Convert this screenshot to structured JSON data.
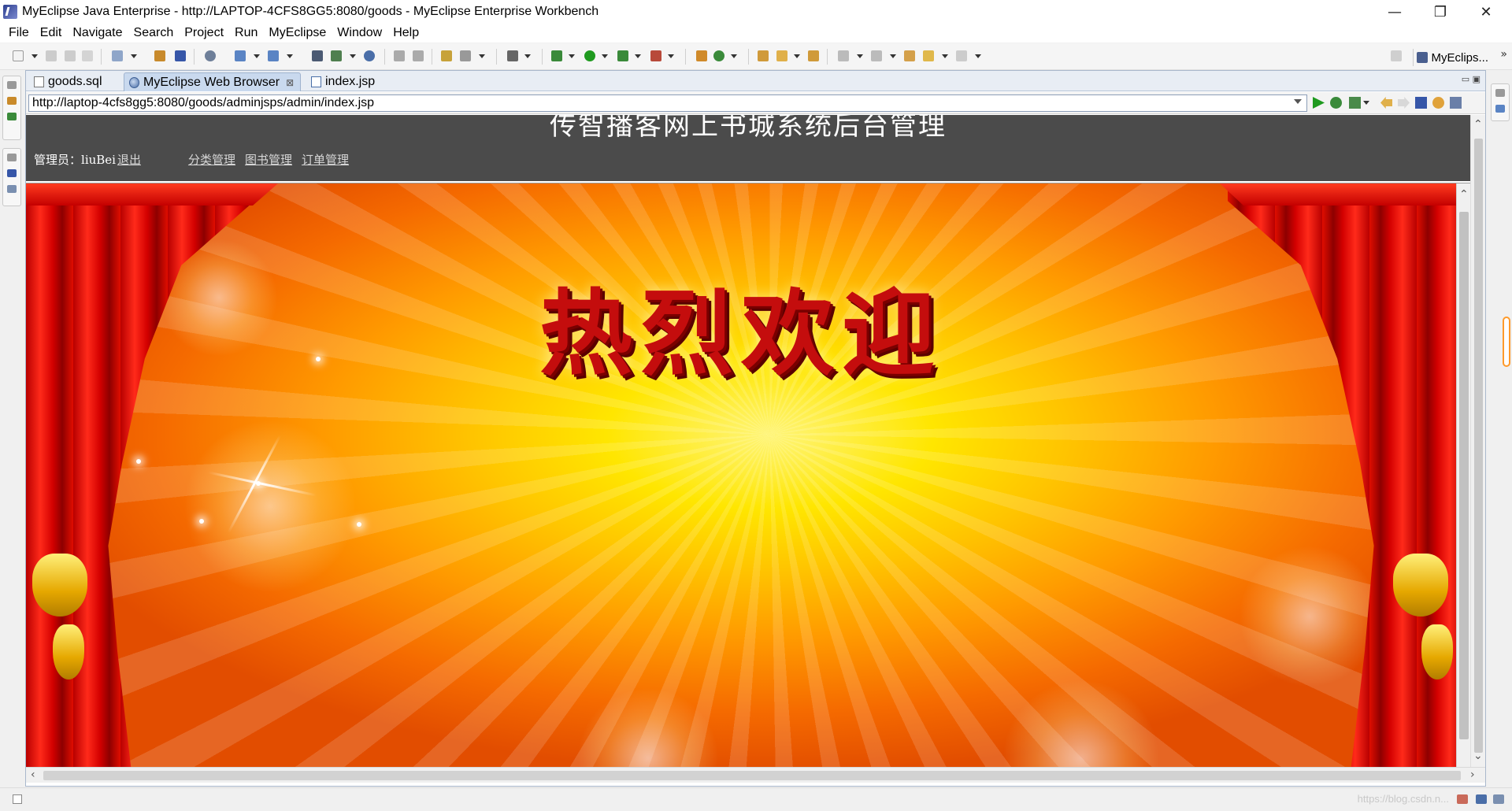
{
  "window": {
    "title": "MyEclipse Java Enterprise - http://LAPTOP-4CFS8GG5:8080/goods - MyEclipse Enterprise Workbench",
    "minimize_glyph": "—",
    "restore_glyph": "❐",
    "close_glyph": "✕"
  },
  "menu": [
    "File",
    "Edit",
    "Navigate",
    "Search",
    "Project",
    "Run",
    "MyEclipse",
    "Window",
    "Help"
  ],
  "perspective": {
    "label": "MyEclips...",
    "more": "»"
  },
  "tabs": [
    {
      "label": "goods.sql",
      "icon": "file-icon"
    },
    {
      "label": "MyEclipse Web Browser",
      "icon": "globe-icon",
      "close": "⊠"
    },
    {
      "label": "index.jsp",
      "icon": "jsp-file-icon"
    }
  ],
  "browser": {
    "url": "http://laptop-4cfs8gg5:8080/goods/adminjsps/admin/index.jsp"
  },
  "page": {
    "header_title": "传智播客网上书城系统后台管理",
    "admin_label": "管理员：",
    "admin_name": "liuBei",
    "logout": "退出",
    "nav": [
      "分类管理",
      "图书管理",
      "订单管理"
    ],
    "welcome": "热烈欢迎"
  },
  "status": {
    "watermark": "https://blog.csdn.n..."
  },
  "colors": {
    "header_bg": "#4b4b4b",
    "curtain_red": "#d30000",
    "welcome_text": "#c40d0d",
    "stage_center": "#ffe600"
  }
}
